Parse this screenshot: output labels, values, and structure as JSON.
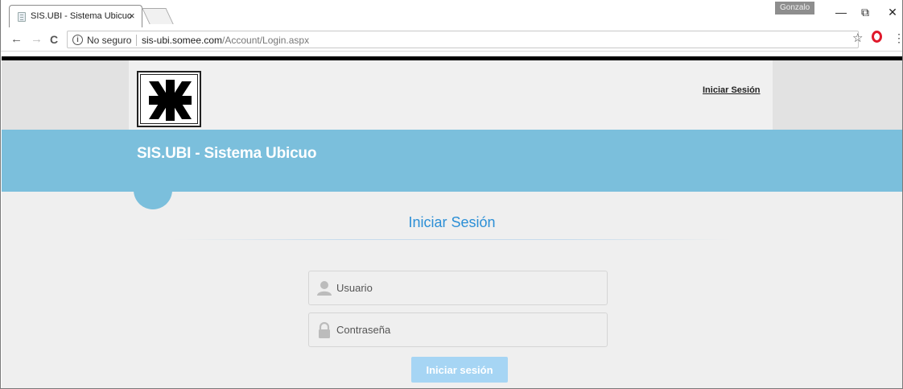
{
  "browser": {
    "tab_title": "SIS.UBI - Sistema Ubicuo",
    "tab_close": "×",
    "profile_name": "Gonzalo",
    "security_label": "No seguro",
    "url_host": "sis-ubi.somee.com",
    "url_path": "/Account/Login.aspx",
    "window_controls": {
      "minimize": "—",
      "restore": "⧉",
      "close": "✕"
    },
    "nav": {
      "back": "←",
      "forward": "→",
      "reload": "C"
    },
    "icons": {
      "info": "i",
      "bookmark": "☆",
      "menu": "⋮"
    }
  },
  "header": {
    "login_link": "Iniciar Sesión"
  },
  "banner": {
    "site_title": "SIS.UBI - Sistema Ubicuo"
  },
  "login": {
    "heading": "Iniciar Sesión",
    "username_placeholder": "Usuario",
    "password_placeholder": "Contraseña",
    "submit_label": "Iniciar sesión"
  },
  "colors": {
    "banner": "#7bbfdc",
    "heading": "#2c8fd6",
    "button": "#a6d5f4",
    "page_background": "#efefef"
  }
}
